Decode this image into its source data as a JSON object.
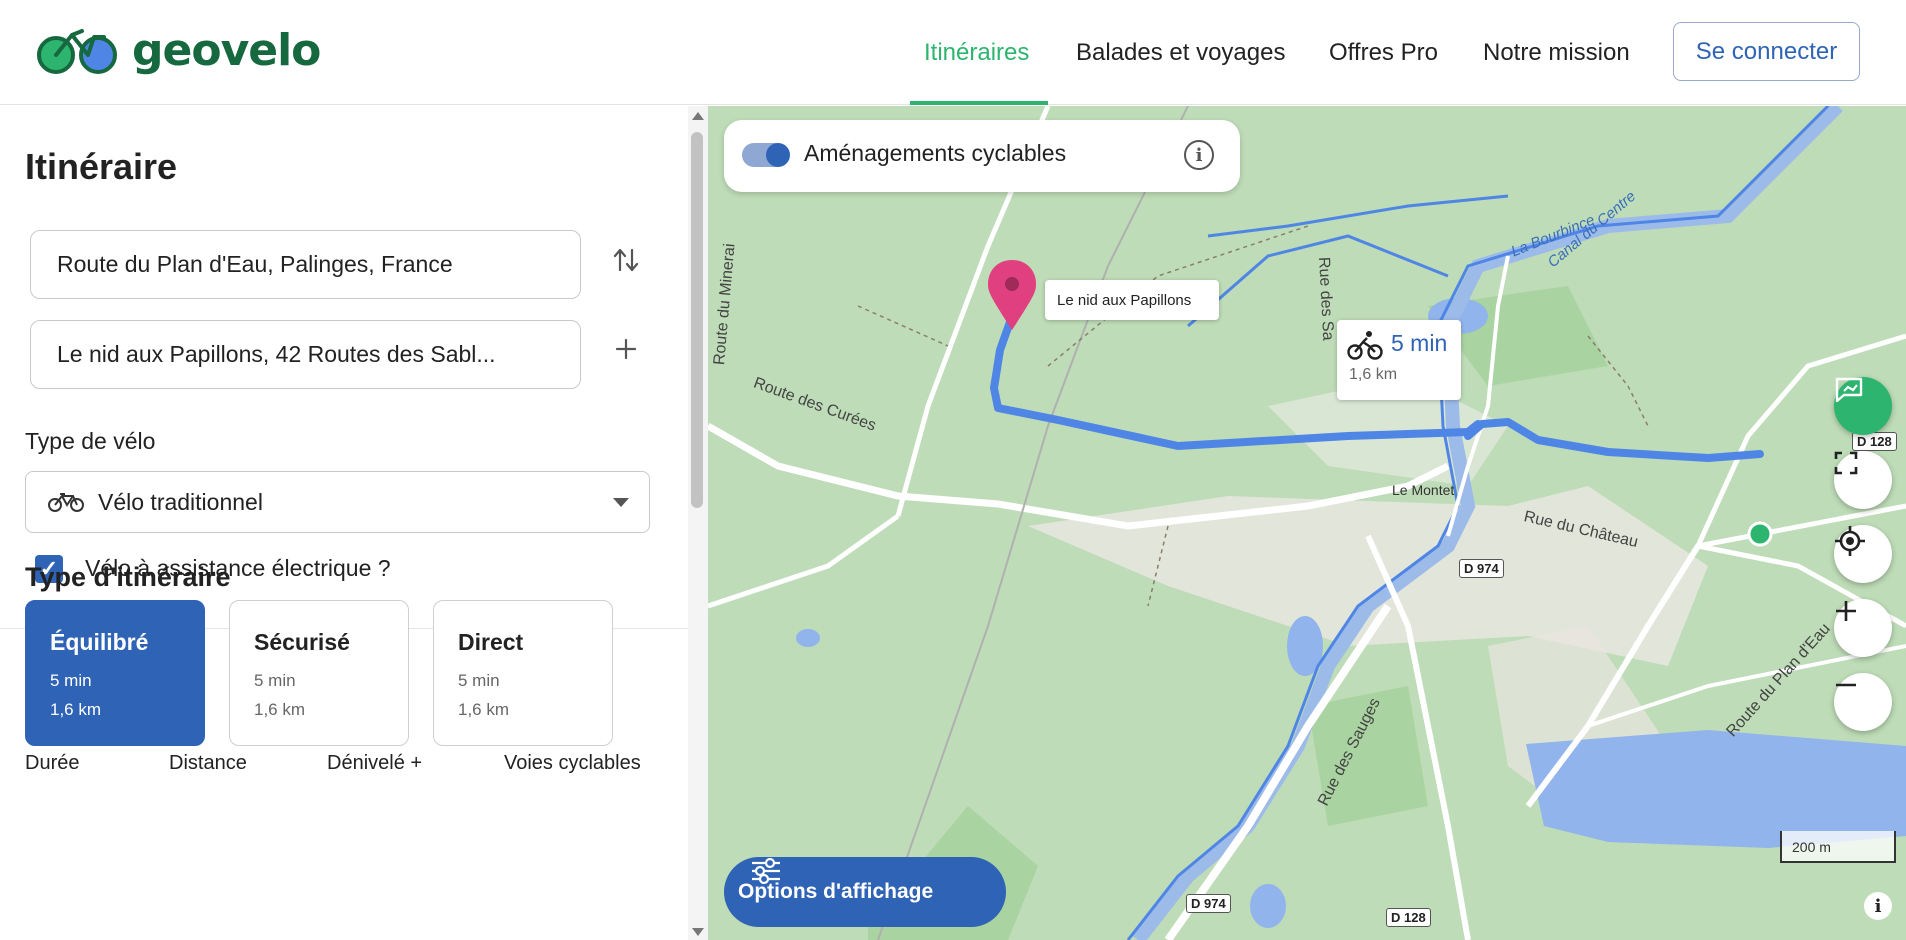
{
  "header": {
    "brand": "geovelo",
    "nav": [
      {
        "label": "Itinéraires",
        "active": true
      },
      {
        "label": "Balades et voyages",
        "active": false
      },
      {
        "label": "Offres Pro",
        "active": false
      },
      {
        "label": "Notre mission",
        "active": false
      }
    ],
    "login_label": "Se connecter"
  },
  "sidebar": {
    "title": "Itinéraire",
    "origin": "Route du Plan d'Eau, Palinges, France",
    "destination": "Le nid aux Papillons, 42 Routes des Sabl...",
    "bike_type_label": "Type de vélo",
    "bike_type_value": "Vélo traditionnel",
    "ebike_label": "Vélo à assistance électrique ?",
    "ebike_checked": true,
    "route_type_title": "Type d'itinéraire",
    "route_types": [
      {
        "title": "Équilibré",
        "duration": "5 min",
        "distance": "1,6 km",
        "selected": true
      },
      {
        "title": "Sécurisé",
        "duration": "5 min",
        "distance": "1,6 km",
        "selected": false
      },
      {
        "title": "Direct",
        "duration": "5 min",
        "distance": "1,6 km",
        "selected": false
      }
    ],
    "stats_headers": [
      "Durée",
      "Distance",
      "Dénivelé +",
      "Voies cyclables"
    ]
  },
  "map": {
    "layer_toggle_label": "Aménagements cyclables",
    "layer_toggle_on": true,
    "destination_label": "Le nid aux Papillons",
    "route_summary": {
      "duration": "5 min",
      "distance": "1,6 km"
    },
    "place_labels": {
      "le_montet": "Le Montet",
      "route_des_curees": "Route des Curées",
      "route_du_minerai": "Route du Minerai",
      "rue_des_sa": "Rue des Sa",
      "rue_du_chateau": "Rue du Château",
      "rue_des_sauges": "Rue des Sauges",
      "route_du_plan_deau": "Route du Plan d'Eau",
      "la_bourbince": "La Bourbince",
      "canal_du_centre": "Canal du Centre"
    },
    "road_signs": [
      "D 128",
      "D 974",
      "D 974",
      "D 128"
    ],
    "scale_label": "200 m",
    "options_label": "Options d'affichage",
    "controls": [
      "report-icon",
      "fullscreen-icon",
      "locate-icon",
      "zoom-in-icon",
      "zoom-out-icon"
    ],
    "colors": {
      "route": "#4f86e6",
      "brand_green": "#2db46e",
      "accent_blue": "#2f63b6",
      "pin": "#e0407f"
    }
  }
}
